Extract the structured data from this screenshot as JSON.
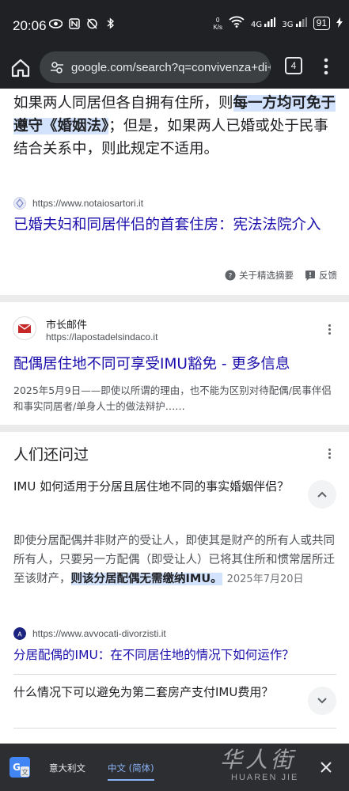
{
  "status_bar": {
    "time": "20:06",
    "net_speed_value": "0",
    "net_speed_unit": "K/s",
    "signal_label": "4G",
    "signal2_label": "3G",
    "battery": "91"
  },
  "toolbar": {
    "url": "google.com/search?q=convivenza+di+fa",
    "tab_count": "4"
  },
  "result1": {
    "snippet_pre": "如果两人同居但各自拥有住所，则",
    "snippet_highlight": "每一方均可免于遵守《婚姻法》",
    "snippet_post": "；但是，如果两人已婚或处于民事结合关系中，则此规定不适用。",
    "source_url": "https://www.notaiosartori.it",
    "title": "已婚夫妇和同居伴侣的首套住房：宪法法院介入",
    "about_label": "关于精选摘要",
    "feedback_label": "反馈"
  },
  "result2": {
    "site_name": "市长邮件",
    "site_url": "https://lapostadelsindaco.it",
    "title": "配偶居住地不同可享受IMU豁免 - 更多信息",
    "description": "2025年5月9日——即使以所谓的理由，也不能为区别对待配偶/民事伴侣和事实同居者/单身人士的做法辩护……"
  },
  "people_also_ask": {
    "heading": "人们还问过",
    "q1": "IMU 如何适用于分居且居住地不同的事实婚姻伴侣？",
    "a1_pre": "即使分居配偶并非财产的受让人，即使其是财产的所有人或共同所有人，只要另一方配偶（即受让人）已将其住所和惯常居所迁至该财产，",
    "a1_highlight": "则该分居配偶无需缴纳IMU。",
    "a1_date": "2025年7月20日",
    "a1_source_url": "https://www.avvocati-divorzisti.it",
    "a1_link_title": "分居配偶的IMU：在不同居住地的情况下如何运作？",
    "q2": "什么情况下可以避免为第二套房产支付IMU费用？"
  },
  "translate_bar": {
    "lang_source": "意大利文",
    "lang_target": "中文 (简体)"
  },
  "watermark": {
    "text_main": "华人街",
    "text_sub": "HUAREN JIE"
  },
  "colors": {
    "link": "#1a0dab",
    "highlight": "#d3e3fd",
    "chrome_dark": "#202124"
  }
}
